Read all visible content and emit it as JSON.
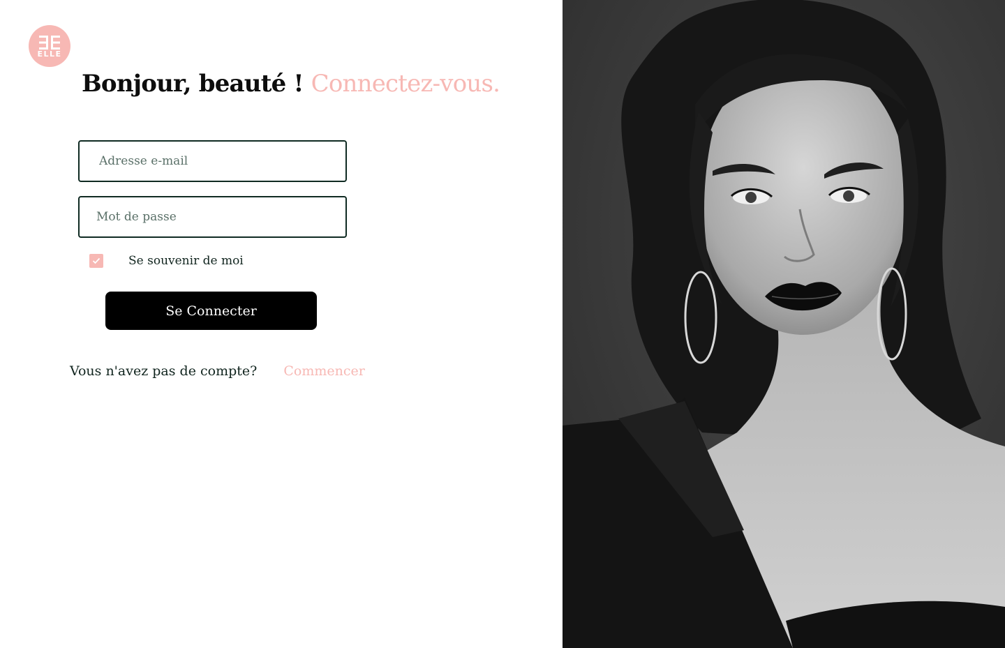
{
  "brand": {
    "logo_text": "ELLE",
    "logo_icon": "double-e-monogram-icon",
    "accent_color": "#f7b8b4"
  },
  "heading": {
    "greeting": "Bonjour, beauté !",
    "accent": "Connectez-vous."
  },
  "form": {
    "email_placeholder": "Adresse e-mail",
    "email_value": "",
    "password_placeholder": "Mot de passe",
    "password_value": "",
    "remember_label": "Se souvenir de moi",
    "remember_checked": true,
    "submit_label": "Se Connecter",
    "submit_color": "#000000"
  },
  "signup": {
    "prompt": "Vous n'avez pas de compte?",
    "link_label": "Commencer"
  },
  "photo": {
    "subject": "black-and-white portrait photo"
  }
}
